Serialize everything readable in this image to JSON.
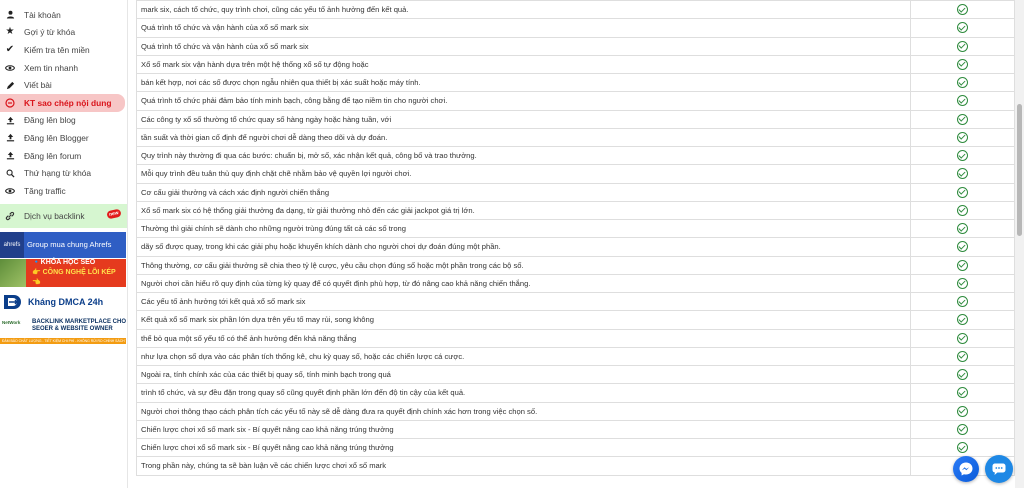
{
  "sidebar": {
    "items": [
      {
        "label": "Tài khoản",
        "icon": "user-icon"
      },
      {
        "label": "Gợi ý từ khóa",
        "icon": "star-icon"
      },
      {
        "label": "Kiểm tra tên miền",
        "icon": "check-icon"
      },
      {
        "label": "Xem tin nhanh",
        "icon": "eye-icon"
      },
      {
        "label": "Viết bài",
        "icon": "pencil-icon"
      },
      {
        "label": "KT sao chép nội dung",
        "icon": "copy-check-icon"
      },
      {
        "label": "Đăng lên blog",
        "icon": "upload-icon"
      },
      {
        "label": "Đăng lên Blogger",
        "icon": "upload-icon"
      },
      {
        "label": "Đăng lên forum",
        "icon": "upload-icon"
      },
      {
        "label": "Thứ hạng từ khóa",
        "icon": "search-icon"
      },
      {
        "label": "Tăng traffic",
        "icon": "eye-icon"
      }
    ],
    "backlink": {
      "label": "Dịch vụ backlink",
      "badge": "new"
    },
    "banners": {
      "ahrefs": {
        "label": "Group mua chung Ahrefs",
        "logo": "ahrefs"
      },
      "seo": {
        "line1": "🔹KHÓA HỌC SEO",
        "line2": "👉 CÔNG NGHỆ LÕI KÉP 👈"
      },
      "dmca": {
        "label": "Kháng DMCA 24h"
      },
      "backlink_market": {
        "logo": "NetWork",
        "title1": "BACKLINK MARKETPLACE CHO",
        "title2": "SEOER & WEBSITE OWNER",
        "strip": "ĐẢM BẢO CHẤT LƯỢNG - TIẾT KIỆM CHI PHÍ - KHÔNG RỦI RO CHÍNH SÁCH THẬT"
      }
    }
  },
  "table": {
    "rows": [
      "mark six, cách tổ chức, quy trình chơi, cũng các yếu tố ảnh hưởng đến kết quả.",
      "Quá trình tổ chức và vận hành của xổ số mark six",
      "Quá trình tổ chức và vận hành của xổ số mark six",
      "Xổ số mark six vận hành dựa trên một hệ thống xổ số tự động hoặc",
      "bán kết hợp, nơi các số được chọn ngẫu nhiên qua thiết bị xác suất hoặc máy tính.",
      "Quá trình tổ chức phải đảm bảo tính minh bạch, công bằng để tạo niềm tin cho người chơi.",
      "Các công ty xổ số thường tổ chức quay số hàng ngày hoặc hàng tuần, với",
      "tần suất và thời gian cố định để người chơi dễ dàng theo dõi và dự đoán.",
      "Quy trình này thường đi qua các bước: chuẩn bị, mở số, xác nhận kết quả, công bố và trao thưởng.",
      "Mỗi quy trình đều tuân thủ quy định chặt chẽ nhằm bảo vệ quyền lợi người chơi.",
      "Cơ cấu giải thưởng và cách xác định người chiến thắng",
      "Xổ số mark six có hệ thống giải thưởng đa dạng, từ giải thưởng nhỏ đến các giải jackpot giá trị lớn.",
      "Thường thì giải chính sẽ dành cho những người trùng đúng tất cả các số trong",
      "dãy số được quay, trong khi các giải phụ hoặc khuyến khích dành cho người chơi dự đoán đúng một phần.",
      "Thông thường, cơ cấu giải thưởng sẽ chia theo tỷ lệ cược, yêu cầu chọn đúng số hoặc một phần trong các bộ số.",
      "Người chơi cần hiểu rõ quy định của từng kỳ quay để có quyết định phù hợp, từ đó nâng cao khả năng chiến thắng.",
      "Các yếu tố ảnh hưởng tới kết quả xổ số mark six",
      "Kết quả xổ số mark six phần lớn dựa trên yếu tố may rủi, song không",
      "thể bỏ qua một số yếu tố có thể ảnh hưởng đến khả năng thắng",
      "như lựa chọn số dựa vào các phân tích thống kê, chu kỳ quay số, hoặc các chiến lược cá cược.",
      "Ngoài ra, tính chính xác của các thiết bị quay số, tính minh bạch trong quá",
      "trình tổ chức, và sự đều đặn trong quay số cũng quyết định phần lớn đến độ tin cậy của kết quả.",
      "Người chơi thông thạo cách phân tích các yếu tố này sẽ dễ dàng đưa ra quyết định chính xác hơn trong việc chọn số.",
      "Chiến lược chơi xổ số mark six - Bí quyết nâng cao khả năng trúng thưởng",
      "Chiến lược chơi xổ số mark six - Bí quyết nâng cao khả năng trúng thưởng",
      "Trong phần này, chúng ta sẽ bàn luận về các chiến lược chơi xổ số mark"
    ],
    "status_icon": "check-circle-icon",
    "status_color": "#2e8b3d"
  },
  "colors": {
    "active_bg": "#f7c6c6",
    "active_text": "#d9141b",
    "backlink_bg": "#d6f6d0"
  }
}
